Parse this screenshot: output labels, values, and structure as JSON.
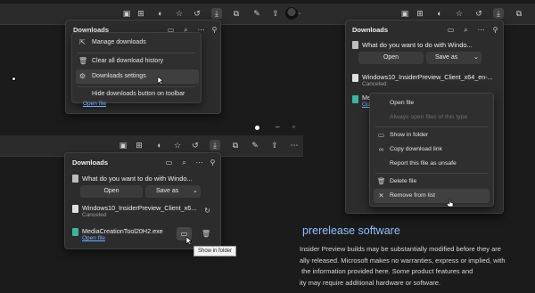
{
  "top_left_panel": {
    "title": "Downloads",
    "menu": [
      {
        "label": "Manage downloads",
        "icon": "external-icon"
      },
      {
        "label": "Clear all download history",
        "icon": "trash-icon"
      },
      {
        "label": "Downloads settings",
        "icon": "gear-icon"
      },
      {
        "label": "Hide downloads button on toolbar",
        "icon": ""
      }
    ],
    "open_file": "Open file"
  },
  "bottom_left_panel": {
    "title": "Downloads",
    "question": "What do you want to do with Windo...",
    "open_label": "Open",
    "save_as_label": "Save as",
    "item1_name": "Windows10_InsiderPreview_Client_x6...",
    "item1_status": "Canceled",
    "item2_name": "MediaCreationTool20H2.exe",
    "item2_link": "Open file",
    "tooltip": "Show in folder"
  },
  "right_panel": {
    "title": "Downloads",
    "question": "What do you want to do with Windo...",
    "open_label": "Open",
    "save_as_label": "Save as",
    "item1_name": "Windows10_InsiderPreview_Client_x64_en-...",
    "item1_status": "Canceled",
    "item2_name_partial": "Me",
    "item2_link_partial": "Op"
  },
  "context_menu": {
    "items": [
      {
        "label": "Open file",
        "icon": "",
        "disabled": false
      },
      {
        "label": "Always open files of this type",
        "icon": "",
        "disabled": true
      },
      {
        "label": "Show in folder",
        "icon": "folder-icon",
        "disabled": false
      },
      {
        "label": "Copy download link",
        "icon": "link-icon",
        "disabled": false
      },
      {
        "label": "Report this file as unsafe",
        "icon": "",
        "disabled": false
      },
      {
        "label": "Delete file",
        "icon": "trash-icon",
        "disabled": false
      },
      {
        "label": "Remove from list",
        "icon": "close-icon",
        "disabled": false
      }
    ]
  },
  "page": {
    "heading": "prerelease software",
    "paragraph_lines": [
      "Insider Preview builds may be substantially modified before they are",
      "ally released. Microsoft makes no warranties, express or implied, with",
      " the information provided here. Some product features and",
      "ity may require additional hardware or software."
    ]
  },
  "colors": {
    "background": "#1b1b1b",
    "panel": "#2c2c2c",
    "link": "#6fb3ff",
    "heading": "#8cc0ff"
  }
}
